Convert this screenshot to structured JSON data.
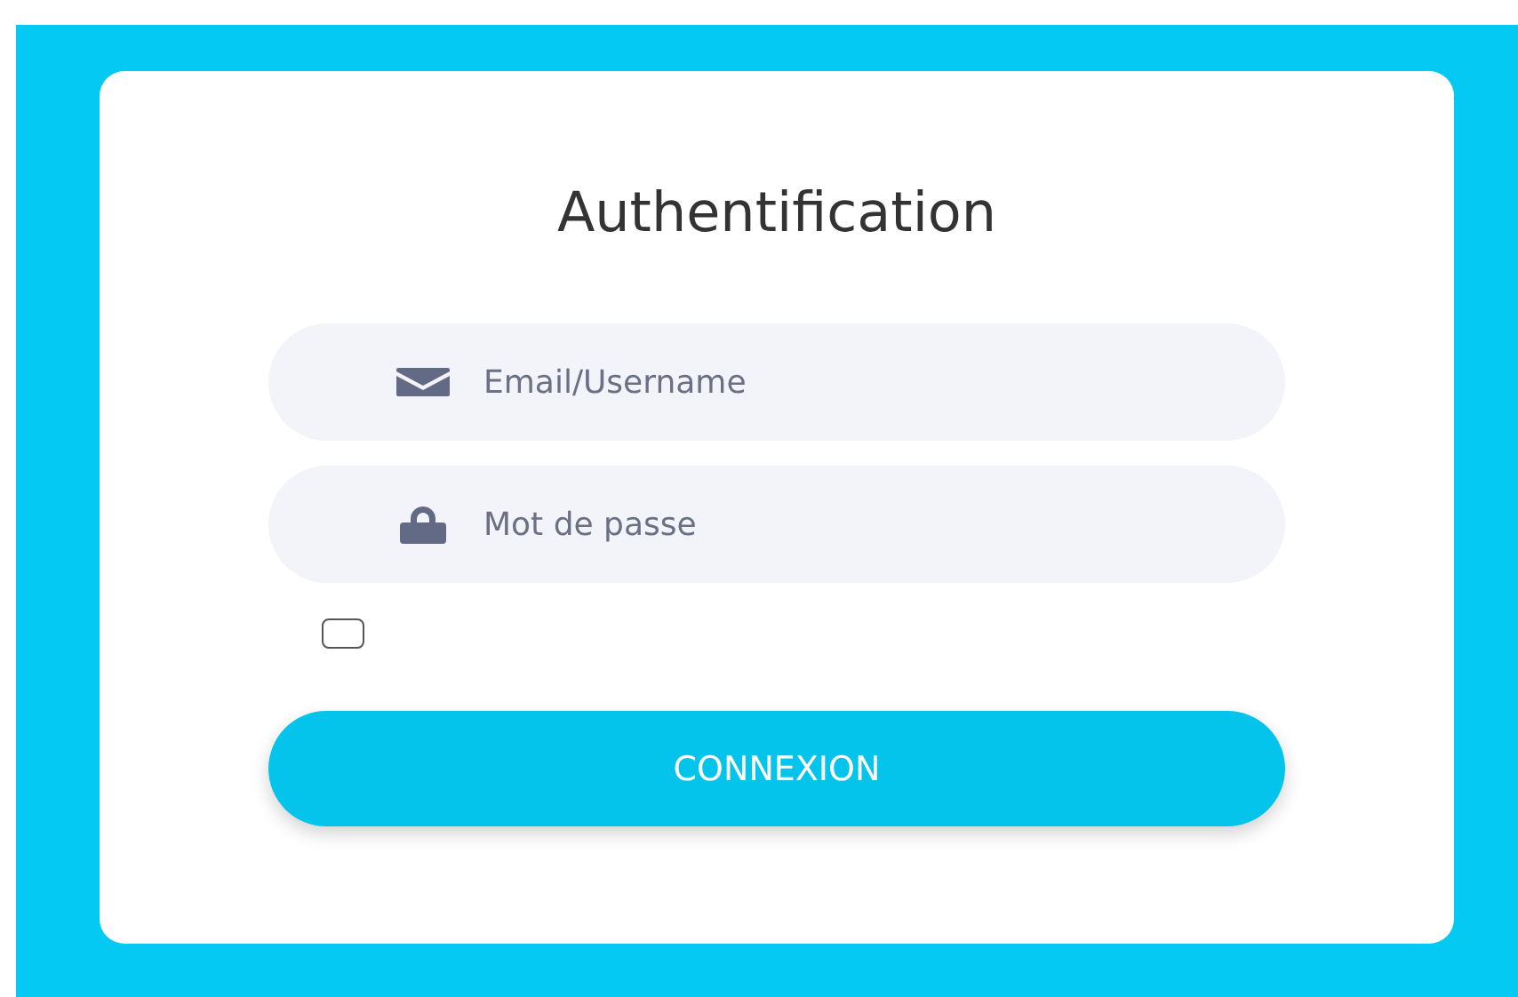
{
  "title": "Authentification",
  "fields": [
    {
      "kind": "email",
      "placeholder": "Email/Username"
    },
    {
      "kind": "password",
      "placeholder": "Mot de passe"
    }
  ],
  "remember": {
    "checked": false
  },
  "button": "CONNEXION"
}
